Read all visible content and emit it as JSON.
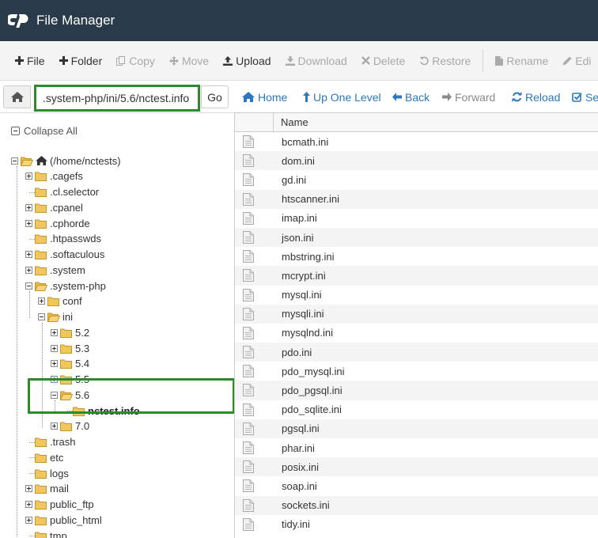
{
  "header": {
    "app_title": "File Manager",
    "logo_icon": "cpanel-logo-icon",
    "bg_color": "#293a4a"
  },
  "toolbar": {
    "items": [
      {
        "label": "File",
        "icon": "plus-icon",
        "enabled": true
      },
      {
        "label": "Folder",
        "icon": "plus-icon",
        "enabled": true
      },
      {
        "label": "Copy",
        "icon": "copy-icon",
        "enabled": false
      },
      {
        "label": "Move",
        "icon": "move-icon",
        "enabled": false
      },
      {
        "label": "Upload",
        "icon": "upload-icon",
        "enabled": true
      },
      {
        "label": "Download",
        "icon": "download-icon",
        "enabled": false
      },
      {
        "label": "Delete",
        "icon": "close-icon",
        "enabled": false
      },
      {
        "label": "Restore",
        "icon": "restore-icon",
        "enabled": false
      },
      {
        "label": "Rename",
        "icon": "rename-icon",
        "enabled": false
      },
      {
        "label": "Edi",
        "icon": "pencil-icon",
        "enabled": false
      }
    ]
  },
  "pathbar": {
    "path_value": ".system-php/ini/5.6/nctest.info",
    "go_label": "Go",
    "nav": [
      {
        "label": "Home",
        "icon": "home-icon",
        "enabled": true
      },
      {
        "label": "Up One Level",
        "icon": "up-arrow-icon",
        "enabled": true
      },
      {
        "label": "Back",
        "icon": "back-arrow-icon",
        "enabled": true
      },
      {
        "label": "Forward",
        "icon": "forward-arrow-icon",
        "enabled": false
      },
      {
        "label": "Reload",
        "icon": "reload-icon",
        "enabled": true
      },
      {
        "label": "Sel",
        "icon": "checkbox-icon",
        "enabled": true
      }
    ]
  },
  "tree": {
    "collapse_all_label": "Collapse All",
    "root_label": "(/home/nctests)",
    "nodes": [
      {
        "label": ".cagefs",
        "toggle": "plus"
      },
      {
        "label": ".cl.selector",
        "toggle": "none"
      },
      {
        "label": ".cpanel",
        "toggle": "plus"
      },
      {
        "label": ".cphorde",
        "toggle": "plus"
      },
      {
        "label": ".htpasswds",
        "toggle": "none"
      },
      {
        "label": ".softaculous",
        "toggle": "plus"
      },
      {
        "label": ".system",
        "toggle": "plus"
      },
      {
        "label": ".system-php",
        "toggle": "minus"
      },
      {
        "label": "conf",
        "toggle": "plus"
      },
      {
        "label": "ini",
        "toggle": "minus"
      },
      {
        "label": "5.2",
        "toggle": "plus"
      },
      {
        "label": "5.3",
        "toggle": "plus"
      },
      {
        "label": "5.4",
        "toggle": "plus"
      },
      {
        "label": "5.5",
        "toggle": "plus"
      },
      {
        "label": "5.6",
        "toggle": "minus"
      },
      {
        "label": "nctest.info",
        "toggle": "none",
        "selected": true
      },
      {
        "label": "7.0",
        "toggle": "plus"
      },
      {
        "label": ".trash",
        "toggle": "none"
      },
      {
        "label": "etc",
        "toggle": "none"
      },
      {
        "label": "logs",
        "toggle": "none"
      },
      {
        "label": "mail",
        "toggle": "plus"
      },
      {
        "label": "public_ftp",
        "toggle": "plus"
      },
      {
        "label": "public_html",
        "toggle": "plus"
      },
      {
        "label": "tmp",
        "toggle": "none"
      }
    ]
  },
  "filelist": {
    "column_name": "Name",
    "files": [
      "bcmath.ini",
      "dom.ini",
      "gd.ini",
      "htscanner.ini",
      "imap.ini",
      "json.ini",
      "mbstring.ini",
      "mcrypt.ini",
      "mysql.ini",
      "mysqli.ini",
      "mysqlnd.ini",
      "pdo.ini",
      "pdo_mysql.ini",
      "pdo_pgsql.ini",
      "pdo_sqlite.ini",
      "pgsql.ini",
      "phar.ini",
      "posix.ini",
      "soap.ini",
      "sockets.ini",
      "tidy.ini"
    ]
  },
  "colors": {
    "link": "#2b78c0",
    "highlight": "#2d8a2d",
    "folder": "#f0c75e"
  }
}
